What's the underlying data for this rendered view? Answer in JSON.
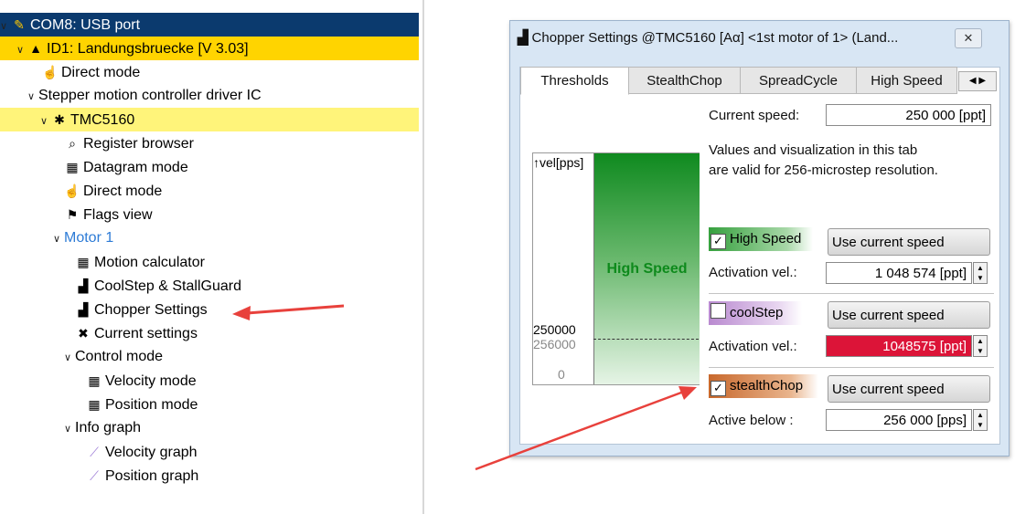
{
  "tree": {
    "port": "COM8: USB port",
    "device": "ID1: Landungsbruecke [V 3.03]",
    "direct_mode_1": "Direct mode",
    "ic_group": "Stepper motion controller driver IC",
    "chip": "TMC5160",
    "register_browser": "Register browser",
    "datagram_mode": "Datagram mode",
    "direct_mode_2": "Direct mode",
    "flags_view": "Flags view",
    "motor": "Motor 1",
    "motion_calculator": "Motion calculator",
    "coolstep": "CoolStep & StallGuard",
    "chopper": "Chopper Settings",
    "current": "Current settings",
    "control_mode": "Control mode",
    "velocity_mode": "Velocity mode",
    "position_mode": "Position mode",
    "info_graph": "Info graph",
    "velocity_graph": "Velocity graph",
    "position_graph": "Position graph"
  },
  "window": {
    "title": "Chopper Settings @TMC5160 [Aα] <1st motor of 1> (Land...",
    "close": "✕",
    "tabs": [
      "Thresholds",
      "StealthChop",
      "SpreadCycle",
      "High Speed"
    ],
    "current_speed_label": "Current speed:",
    "current_speed_value": "250 000 [ppt]",
    "info_line1": "Values and visualization in this tab",
    "info_line2": "are valid for 256-microstep resolution.",
    "viz": {
      "axis_label": "↑vel[pps]",
      "bar_label": "High Speed",
      "tick_250000": "250000",
      "tick_256000": "256000",
      "tick_0": "0"
    },
    "high_speed": {
      "checkbox_label": "High Speed",
      "checked": "✓",
      "button": "Use current speed",
      "activation_label": "Activation vel.:",
      "activation_value": "1 048 574 [ppt]"
    },
    "coolstep": {
      "checkbox_label": "coolStep",
      "button": "Use current speed",
      "activation_label": "Activation vel.:",
      "activation_value": "1048575 [ppt]"
    },
    "stealthchop": {
      "checkbox_label": "stealthChop",
      "checked": "✓",
      "button": "Use current speed",
      "active_label": "Active below :",
      "active_value": "256 000 [pps]"
    }
  },
  "colors": {
    "selected": "#0b3a6e",
    "device_highlight": "#ffd400",
    "chip_highlight": "#fff47a",
    "error_field": "#dc1438",
    "arrow": "#e8413c"
  }
}
